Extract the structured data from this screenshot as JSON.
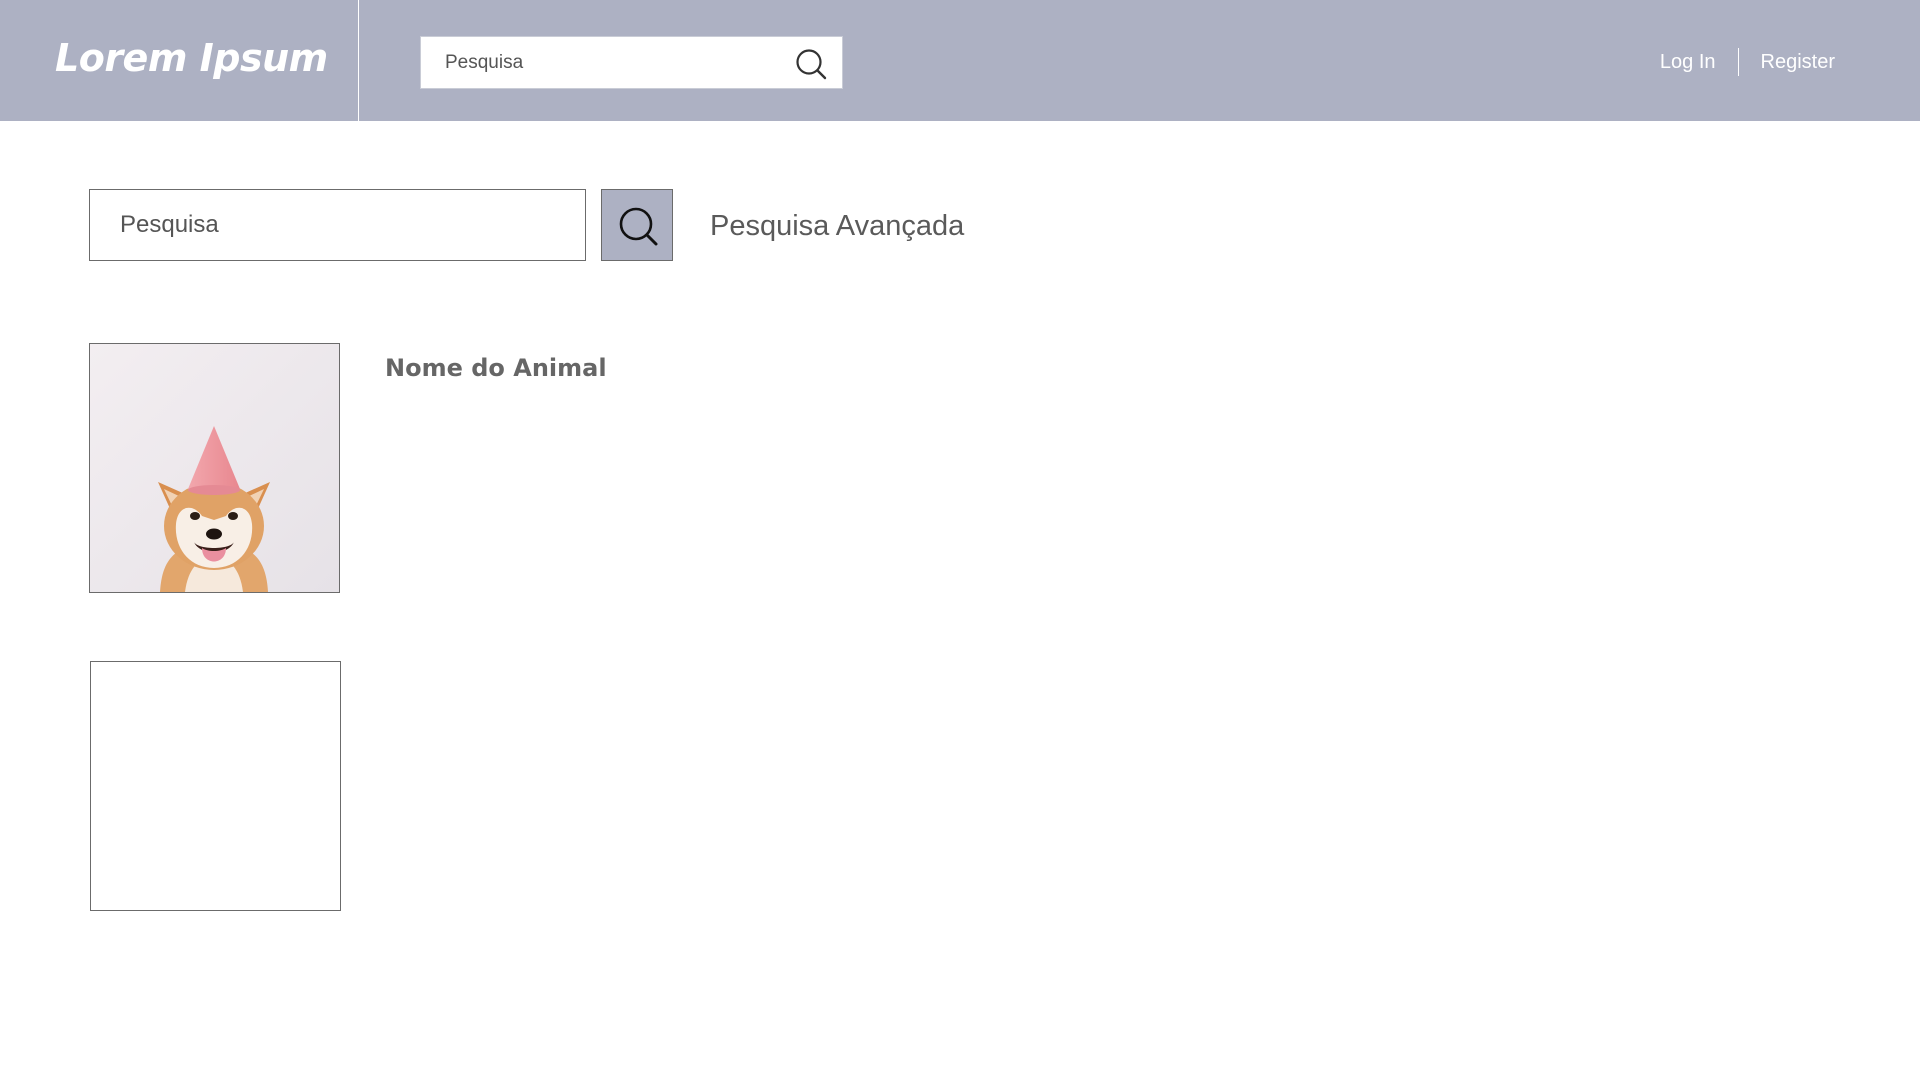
{
  "header": {
    "logo_text": "Lorem Ipsum",
    "search": {
      "placeholder": "Pesquisa",
      "icon": "search-icon"
    },
    "auth": {
      "login_label": "Log In",
      "register_label": "Register"
    }
  },
  "main": {
    "search": {
      "placeholder": "Pesquisa",
      "button_icon": "search-icon"
    },
    "advanced_search_label": "Pesquisa Avançada"
  },
  "results": [
    {
      "name": "Nome do Animal",
      "image": "shiba-dog-party-hat"
    },
    {
      "name": "",
      "image": "empty-placeholder"
    }
  ],
  "colors": {
    "header_bg": "#adb1c3",
    "header_text": "#ffffff",
    "button_bg": "#adb1c3",
    "border": "#6b6b6b",
    "text_muted": "#5a5a5a"
  }
}
